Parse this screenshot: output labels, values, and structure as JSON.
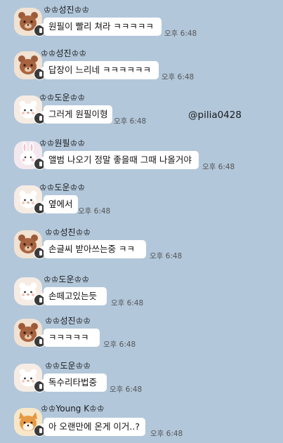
{
  "watermark": "@pilia0428",
  "messages": [
    {
      "sender": "♔♔성진♔♔",
      "text": "원필이 빨리 쳐라 ㅋㅋㅋㅋㅋ",
      "time": "오후 6:48",
      "avatar": "brown-bear"
    },
    {
      "sender": "♔♔성진♔♔",
      "text": "답장이 느리네 ㅋㅋㅋㅋㅋㅋ",
      "time": "오후 6:48",
      "avatar": "brown-bear"
    },
    {
      "sender": "♔♔도운♔♔",
      "text": "그러게 원필이형",
      "time": "오후 6:48",
      "avatar": "white-bear"
    },
    {
      "sender": "♔♔원필♔♔",
      "text": "앨범 나오기 정말 좋을때 그때 나올거야",
      "time": "오후 6:48",
      "avatar": "pink-bunny"
    },
    {
      "sender": "♔♔도운♔♔",
      "text": "옆에서",
      "time": "오후 6:48",
      "avatar": "white-bear"
    },
    {
      "sender": "♔♔성진♔♔",
      "text": "손글씨 받아쓰는중 ㅋㅋ",
      "time": "오후 6:48",
      "avatar": "brown-bear"
    },
    {
      "sender": "♔♔도운♔♔",
      "text": "손떼고있는듯",
      "time": "오후 6:48",
      "avatar": "white-bear"
    },
    {
      "sender": "♔♔성진♔♔",
      "text": "ㅋㅋㅋㅋㅋ",
      "time": "오후 6:48",
      "avatar": "brown-bear"
    },
    {
      "sender": "♔♔도운♔♔",
      "text": "독수리타법중",
      "time": "오후 6:48",
      "avatar": "white-bear"
    },
    {
      "sender": "♔♔Young K♔♔",
      "text": "아 오랜만에 온게 이거..?",
      "time": "오후 6:48",
      "avatar": "shiba-dog"
    }
  ]
}
